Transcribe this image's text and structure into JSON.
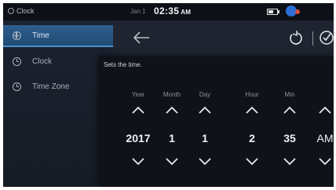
{
  "status_bar": {
    "app_name": "Clock",
    "date": "Jan 1",
    "time": "02:35",
    "ampm": "AM"
  },
  "sidebar": {
    "items": [
      {
        "label": "Time",
        "icon": "globe-icon",
        "active": true
      },
      {
        "label": "Clock",
        "icon": "clock-icon",
        "active": false
      },
      {
        "label": "Time Zone",
        "icon": "clock-icon",
        "active": false
      }
    ]
  },
  "popup": {
    "title": "Sets the time.",
    "columns": [
      {
        "label": "Year",
        "value": "2017"
      },
      {
        "label": "Month",
        "value": "1"
      },
      {
        "label": "Day",
        "value": "1"
      },
      {
        "label": "Hour",
        "value": "2"
      },
      {
        "label": "Min",
        "value": "35"
      },
      {
        "label": "",
        "value": "AM"
      }
    ]
  },
  "colors": {
    "background": "#1e2430",
    "popup_background": "#0f1319",
    "active_item": "#2e5f8f",
    "accent_line": "#4d8fd0"
  }
}
